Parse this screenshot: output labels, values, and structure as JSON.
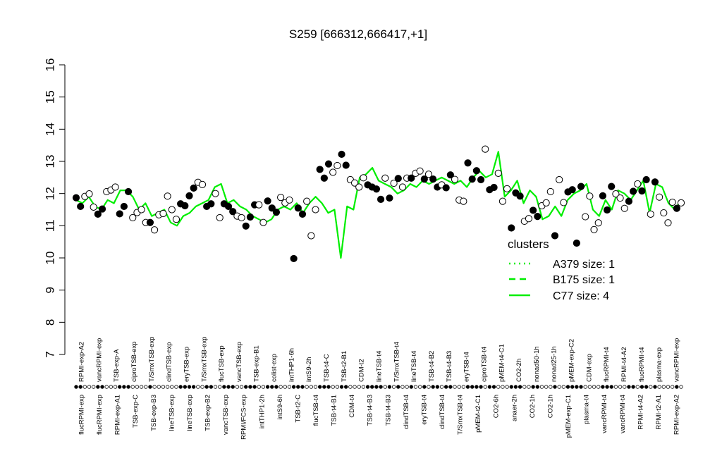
{
  "chart_data": {
    "type": "line",
    "title": "S259 [666312,666417,+1]",
    "xlabel": "",
    "ylabel": "",
    "ylim": [
      7,
      16
    ],
    "yticks": [
      7,
      8,
      9,
      10,
      11,
      12,
      13,
      14,
      15,
      16
    ],
    "grid": false,
    "top_labels": [
      "RPMI-exp-A2",
      "vancRPMI-exp",
      "TSB-exp-A",
      "ciproTSB-exp",
      "T/SmxTSB-exp",
      "clindTSB-exp",
      "eryTSB-exp",
      "T/SmxTSB-exp",
      "flucTSB-exp",
      "vancTSB-exp",
      "TSB-exp-B1",
      "colist-exp",
      "intTHP1-6h",
      "intS9-2h",
      "TSB-t4-C",
      "TSB-t2-B1",
      "CDM-t2",
      "lineTSB-t4",
      "T/SmxTSB-t4",
      "lineTSB-t4",
      "TSB-t4-B2",
      "TSB-t4-B3",
      "eryTSB-t4",
      "ciproTSB-t4",
      "pMEM-t4-C1",
      "CO2-2h",
      "nonad50-1h",
      "nonad25-1h",
      "pMEM-exp-C2",
      "CDM-exp",
      "flucRPMI-t4",
      "RPMI-t4-A2",
      "flucRPMI-t4",
      "plasma-exp",
      "vancRPMI-exp"
    ],
    "bottom_labels": [
      "flucRPMI-exp",
      "flucRPMI-exp",
      "RPMI-exp-A1",
      "TSB-exp-C",
      "TSB-exp-B3",
      "lineTSB-exp",
      "lineTSB-exp",
      "TSB-exp-B2",
      "vancTSB-exp",
      "RPMI/FCS-exp",
      "intTHP1-2h",
      "intS9-6h",
      "TSB-t2-C",
      "flucTSB-t4",
      "TSB-t4-B1",
      "CDM-t4",
      "TSB-t4-B3",
      "TSB-t4-B3",
      "clindTSB-t4",
      "eryTSB-t4",
      "clindTSB-t4",
      "T/SmxTSB-t4",
      "pMEM-t2-C1",
      "CO2-6h",
      "anaer-2h",
      "CO2-1h",
      "CO2-1h",
      "pMEM-exp-C1",
      "plasma-t4",
      "vancRPMI-t4",
      "vancRPMI-t4",
      "RPMI-t4-A2",
      "RPMI-t2-A1",
      "RPMI-exp-A2"
    ],
    "legend": {
      "title": "clusters",
      "placement": "right",
      "items": [
        "A379 size: 1",
        "B175 size: 1",
        "C77 size: 4"
      ],
      "line_styles": [
        "dotted",
        "dashed",
        "solid"
      ]
    },
    "colors": {
      "line": "#00ee00",
      "points": "#000000",
      "legend_text": "#00ee00"
    },
    "series": [
      {
        "values": [
          11.8,
          11.7,
          11.9,
          11.6,
          11.5,
          11.8,
          11.7,
          12.1,
          12.1,
          11.9,
          11.5,
          11.7,
          11.3,
          11.4,
          11.5,
          11.1,
          11.0,
          11.3,
          11.4,
          11.6,
          11.7,
          11.8,
          12.2,
          12.3,
          11.7,
          11.8,
          11.6,
          11.5,
          11.3,
          11.2,
          11.1,
          11.2,
          11.5,
          11.6,
          11.5,
          11.7,
          11.4,
          11.7,
          11.9,
          11.7,
          11.4,
          11.5,
          10.0,
          11.6,
          11.5,
          12.5,
          12.6,
          12.8,
          12.4,
          12.3,
          12.2,
          12.0,
          12.1,
          12.3,
          12.2,
          12.4,
          12.3,
          12.4,
          12.5,
          12.4,
          12.3,
          12.4,
          12.2,
          12.5,
          12.7,
          12.5,
          12.6,
          13.3,
          11.9,
          12.1,
          12.4,
          11.7,
          12.1,
          11.9,
          11.2,
          11.3,
          11.6,
          11.3,
          11.8,
          12.0,
          12.1,
          12.3,
          11.5,
          11.3,
          11.8,
          11.5,
          12.1,
          12.0,
          11.8,
          12.1,
          12.4,
          11.4,
          12.3,
          12.2,
          11.7,
          11.5,
          11.8
        ]
      }
    ],
    "points": [
      {
        "x": 1,
        "y": 11.87,
        "filled": true
      },
      {
        "x": 2,
        "y": 11.6,
        "filled": true
      },
      {
        "x": 3,
        "y": 11.91,
        "filled": false
      },
      {
        "x": 4,
        "y": 11.99,
        "filled": false
      },
      {
        "x": 5,
        "y": 11.58,
        "filled": false
      },
      {
        "x": 6,
        "y": 11.36,
        "filled": true
      },
      {
        "x": 7,
        "y": 11.52,
        "filled": true
      },
      {
        "x": 8,
        "y": 12.06,
        "filled": false
      },
      {
        "x": 9,
        "y": 12.11,
        "filled": false
      },
      {
        "x": 10,
        "y": 12.2,
        "filled": false
      },
      {
        "x": 11,
        "y": 11.37,
        "filled": true
      },
      {
        "x": 12,
        "y": 11.6,
        "filled": true
      },
      {
        "x": 13,
        "y": 12.06,
        "filled": true
      },
      {
        "x": 14,
        "y": 11.25,
        "filled": false
      },
      {
        "x": 15,
        "y": 11.41,
        "filled": false
      },
      {
        "x": 16,
        "y": 11.5,
        "filled": false
      },
      {
        "x": 17,
        "y": 11.1,
        "filled": false
      },
      {
        "x": 18,
        "y": 11.1,
        "filled": true
      },
      {
        "x": 19,
        "y": 10.87,
        "filled": false
      },
      {
        "x": 20,
        "y": 11.34,
        "filled": false
      },
      {
        "x": 21,
        "y": 11.38,
        "filled": false
      },
      {
        "x": 22,
        "y": 11.92,
        "filled": false
      },
      {
        "x": 23,
        "y": 11.5,
        "filled": false
      },
      {
        "x": 24,
        "y": 11.2,
        "filled": false
      },
      {
        "x": 25,
        "y": 11.68,
        "filled": true
      },
      {
        "x": 26,
        "y": 11.62,
        "filled": true
      },
      {
        "x": 27,
        "y": 11.93,
        "filled": true
      },
      {
        "x": 28,
        "y": 12.17,
        "filled": true
      },
      {
        "x": 29,
        "y": 12.35,
        "filled": false
      },
      {
        "x": 30,
        "y": 12.28,
        "filled": false
      },
      {
        "x": 31,
        "y": 11.6,
        "filled": true
      },
      {
        "x": 32,
        "y": 11.68,
        "filled": true
      },
      {
        "x": 33,
        "y": 12.0,
        "filled": false
      },
      {
        "x": 34,
        "y": 11.25,
        "filled": false
      },
      {
        "x": 35,
        "y": 11.68,
        "filled": true
      },
      {
        "x": 36,
        "y": 11.6,
        "filled": true
      },
      {
        "x": 37,
        "y": 11.44,
        "filled": true
      },
      {
        "x": 38,
        "y": 11.3,
        "filled": false
      },
      {
        "x": 39,
        "y": 11.25,
        "filled": false
      },
      {
        "x": 40,
        "y": 10.99,
        "filled": true
      },
      {
        "x": 41,
        "y": 11.27,
        "filled": true
      },
      {
        "x": 42,
        "y": 11.65,
        "filled": true
      },
      {
        "x": 43,
        "y": 11.65,
        "filled": false
      },
      {
        "x": 44,
        "y": 11.1,
        "filled": false
      },
      {
        "x": 45,
        "y": 11.77,
        "filled": true
      },
      {
        "x": 46,
        "y": 11.55,
        "filled": true
      },
      {
        "x": 47,
        "y": 11.42,
        "filled": true
      },
      {
        "x": 48,
        "y": 11.88,
        "filled": false
      },
      {
        "x": 49,
        "y": 11.71,
        "filled": false
      },
      {
        "x": 50,
        "y": 11.8,
        "filled": false
      },
      {
        "x": 51,
        "y": 9.98,
        "filled": true
      },
      {
        "x": 52,
        "y": 11.55,
        "filled": true
      },
      {
        "x": 53,
        "y": 11.36,
        "filled": true
      },
      {
        "x": 54,
        "y": 11.76,
        "filled": false
      },
      {
        "x": 55,
        "y": 10.69,
        "filled": false
      },
      {
        "x": 56,
        "y": 11.5,
        "filled": false
      },
      {
        "x": 57,
        "y": 12.75,
        "filled": true
      },
      {
        "x": 58,
        "y": 12.48,
        "filled": true
      },
      {
        "x": 59,
        "y": 12.92,
        "filled": true
      },
      {
        "x": 60,
        "y": 12.66,
        "filled": false
      },
      {
        "x": 61,
        "y": 12.87,
        "filled": false
      },
      {
        "x": 62,
        "y": 13.22,
        "filled": true
      },
      {
        "x": 63,
        "y": 12.88,
        "filled": true
      },
      {
        "x": 64,
        "y": 12.43,
        "filled": false
      },
      {
        "x": 65,
        "y": 12.33,
        "filled": false
      },
      {
        "x": 66,
        "y": 12.2,
        "filled": false
      },
      {
        "x": 67,
        "y": 12.49,
        "filled": false
      },
      {
        "x": 68,
        "y": 12.27,
        "filled": true
      },
      {
        "x": 69,
        "y": 12.2,
        "filled": true
      },
      {
        "x": 70,
        "y": 12.14,
        "filled": true
      },
      {
        "x": 71,
        "y": 11.82,
        "filled": true
      },
      {
        "x": 72,
        "y": 12.48,
        "filled": false
      },
      {
        "x": 73,
        "y": 11.86,
        "filled": true
      },
      {
        "x": 74,
        "y": 12.32,
        "filled": false
      },
      {
        "x": 75,
        "y": 12.47,
        "filled": true
      },
      {
        "x": 76,
        "y": 12.2,
        "filled": false
      },
      {
        "x": 77,
        "y": 12.48,
        "filled": false
      },
      {
        "x": 78,
        "y": 12.48,
        "filled": true
      },
      {
        "x": 79,
        "y": 12.63,
        "filled": false
      },
      {
        "x": 80,
        "y": 12.7,
        "filled": false
      },
      {
        "x": 81,
        "y": 12.45,
        "filled": true
      },
      {
        "x": 82,
        "y": 12.6,
        "filled": false
      },
      {
        "x": 83,
        "y": 12.45,
        "filled": true
      },
      {
        "x": 84,
        "y": 12.2,
        "filled": true
      },
      {
        "x": 85,
        "y": 12.27,
        "filled": false
      },
      {
        "x": 86,
        "y": 12.18,
        "filled": true
      },
      {
        "x": 87,
        "y": 12.58,
        "filled": true
      },
      {
        "x": 88,
        "y": 12.44,
        "filled": false
      },
      {
        "x": 89,
        "y": 11.8,
        "filled": false
      },
      {
        "x": 90,
        "y": 11.76,
        "filled": false
      },
      {
        "x": 91,
        "y": 12.95,
        "filled": true
      },
      {
        "x": 92,
        "y": 12.45,
        "filled": true
      },
      {
        "x": 93,
        "y": 12.71,
        "filled": true
      },
      {
        "x": 94,
        "y": 12.43,
        "filled": true
      },
      {
        "x": 95,
        "y": 13.38,
        "filled": false
      },
      {
        "x": 96,
        "y": 12.12,
        "filled": true
      },
      {
        "x": 97,
        "y": 12.19,
        "filled": true
      },
      {
        "x": 98,
        "y": 12.63,
        "filled": false
      },
      {
        "x": 99,
        "y": 11.76,
        "filled": false
      },
      {
        "x": 100,
        "y": 12.15,
        "filled": false
      },
      {
        "x": 101,
        "y": 10.93,
        "filled": true
      },
      {
        "x": 102,
        "y": 12.02,
        "filled": true
      },
      {
        "x": 103,
        "y": 11.92,
        "filled": true
      },
      {
        "x": 104,
        "y": 11.14,
        "filled": false
      },
      {
        "x": 105,
        "y": 11.22,
        "filled": false
      },
      {
        "x": 106,
        "y": 11.48,
        "filled": true
      },
      {
        "x": 107,
        "y": 11.29,
        "filled": true
      },
      {
        "x": 108,
        "y": 11.62,
        "filled": false
      },
      {
        "x": 109,
        "y": 11.71,
        "filled": false
      },
      {
        "x": 110,
        "y": 12.06,
        "filled": false
      },
      {
        "x": 111,
        "y": 10.69,
        "filled": true
      },
      {
        "x": 112,
        "y": 12.43,
        "filled": false
      },
      {
        "x": 113,
        "y": 11.72,
        "filled": false
      },
      {
        "x": 114,
        "y": 12.05,
        "filled": true
      },
      {
        "x": 115,
        "y": 12.12,
        "filled": true
      },
      {
        "x": 116,
        "y": 10.46,
        "filled": true
      },
      {
        "x": 117,
        "y": 12.22,
        "filled": true
      },
      {
        "x": 118,
        "y": 11.28,
        "filled": false
      },
      {
        "x": 119,
        "y": 11.92,
        "filled": false
      },
      {
        "x": 120,
        "y": 10.88,
        "filled": false
      },
      {
        "x": 121,
        "y": 11.09,
        "filled": false
      },
      {
        "x": 122,
        "y": 11.93,
        "filled": true
      },
      {
        "x": 123,
        "y": 11.49,
        "filled": true
      },
      {
        "x": 124,
        "y": 12.22,
        "filled": true
      },
      {
        "x": 125,
        "y": 11.99,
        "filled": false
      },
      {
        "x": 126,
        "y": 11.86,
        "filled": false
      },
      {
        "x": 127,
        "y": 11.54,
        "filled": false
      },
      {
        "x": 128,
        "y": 11.76,
        "filled": true
      },
      {
        "x": 129,
        "y": 12.07,
        "filled": true
      },
      {
        "x": 130,
        "y": 12.3,
        "filled": false
      },
      {
        "x": 131,
        "y": 12.08,
        "filled": true
      },
      {
        "x": 132,
        "y": 12.43,
        "filled": true
      },
      {
        "x": 133,
        "y": 11.36,
        "filled": false
      },
      {
        "x": 134,
        "y": 12.36,
        "filled": true
      },
      {
        "x": 135,
        "y": 11.89,
        "filled": false
      },
      {
        "x": 136,
        "y": 11.4,
        "filled": false
      },
      {
        "x": 137,
        "y": 11.09,
        "filled": false
      },
      {
        "x": 138,
        "y": 11.73,
        "filled": false
      },
      {
        "x": 139,
        "y": 11.54,
        "filled": true
      },
      {
        "x": 140,
        "y": 11.71,
        "filled": false
      }
    ]
  }
}
